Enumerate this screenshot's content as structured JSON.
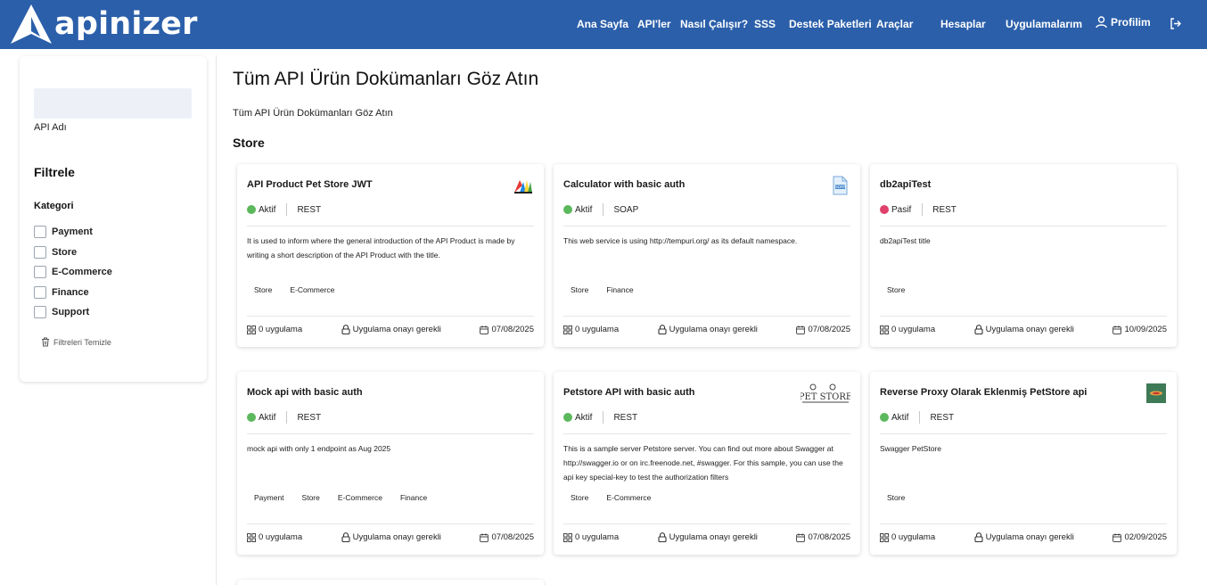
{
  "header": {
    "logo_text": "apinizer",
    "nav": {
      "home": "Ana Sayfa",
      "apis": "API'ler",
      "how_it_works": "Nasıl Çalışır?",
      "faq": "SSS",
      "support": "Destek Paketleri",
      "tools": "Araçlar",
      "accounts": "Hesaplar",
      "apps": "Uygulamalarım",
      "profile": "Profilim"
    }
  },
  "sidebar": {
    "search_label": "API Adı",
    "search_placeholder": "",
    "filter_title": "Filtrele",
    "category_title": "Kategori",
    "categories": [
      "Payment",
      "Store",
      "E-Commerce",
      "Finance",
      "Support"
    ],
    "clear_label": "Filtreleri Temizle"
  },
  "main": {
    "title": "Tüm API Ürün Dokümanları Göz Atın",
    "subtitle": "Tüm API Ürün Dokümanları Göz Atın",
    "section": "Store",
    "footer_apps": "0 uygulama",
    "footer_approval": "Uygulama onayı gerekli",
    "cards": [
      {
        "title": "API Product Pet Store JWT",
        "status": "Aktif",
        "status_color": "#5cb85c",
        "type": "REST",
        "logo": "apinizer-colorful-logo",
        "description": "It is used to inform where the general introduction of the API Product is made by writing a short description of the API Product with the title.",
        "tags": [
          "Store",
          "E-Commerce"
        ],
        "date": "07/08/2025"
      },
      {
        "title": "Calculator with basic auth",
        "status": "Aktif",
        "status_color": "#5cb85c",
        "type": "SOAP",
        "logo": "soap-document-icon",
        "description": "This web service is using http://tempuri.org/ as its default namespace.",
        "tags": [
          "Store",
          "Finance"
        ],
        "date": "07/08/2025"
      },
      {
        "title": "db2apiTest",
        "status": "Pasif",
        "status_color": "#e0416a",
        "type": "REST",
        "logo": "",
        "description": "db2apiTest title",
        "tags": [
          "Store"
        ],
        "date": "10/09/2025"
      },
      {
        "title": "Mock api with basic auth",
        "status": "Aktif",
        "status_color": "#5cb85c",
        "type": "REST",
        "logo": "",
        "description": "mock api with only 1 endpoint as Aug 2025",
        "tags": [
          "Payment",
          "Store",
          "E-Commerce",
          "Finance"
        ],
        "date": "07/08/2025"
      },
      {
        "title": "Petstore API with basic auth",
        "status": "Aktif",
        "status_color": "#5cb85c",
        "type": "REST",
        "logo": "pet-store-logo",
        "description": "This is a sample server Petstore server. You can find out more about Swagger at http://swagger.io or on irc.freenode.net, #swagger. For this sample, you can use the api key special-key to test the authorization filters",
        "tags": [
          "Store",
          "E-Commerce"
        ],
        "date": "07/08/2025"
      },
      {
        "title": "Reverse Proxy Olarak Eklenmiş PetStore api",
        "status": "Aktif",
        "status_color": "#5cb85c",
        "type": "REST",
        "logo": "green-square-logo",
        "description": "Swagger PetStore",
        "tags": [
          "Store"
        ],
        "date": "02/09/2025"
      }
    ]
  },
  "colors": {
    "header_bg": "#2b5faa",
    "active": "#5cb85c",
    "passive": "#e0416a"
  }
}
